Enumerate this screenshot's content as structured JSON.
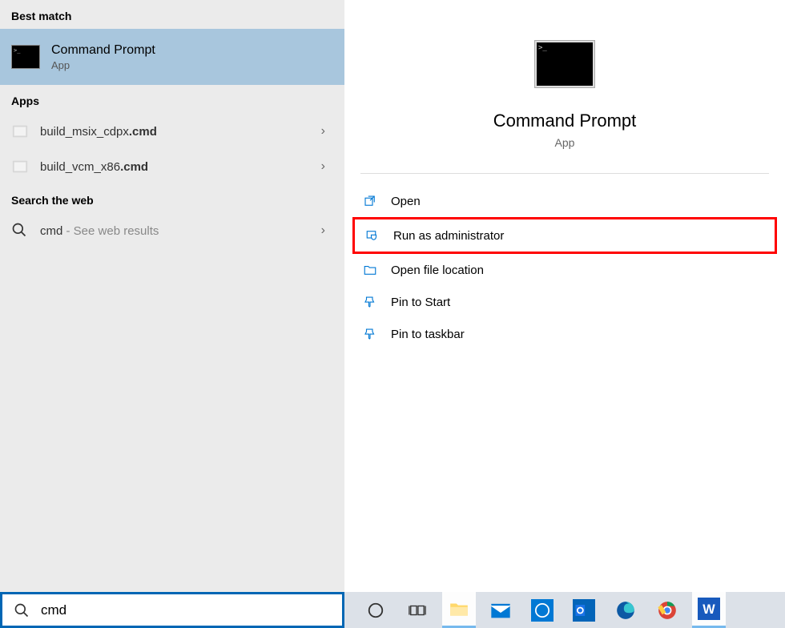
{
  "leftPanel": {
    "sections": {
      "bestMatch": {
        "heading": "Best match",
        "item": {
          "title": "Command Prompt",
          "subtitle": "App"
        }
      },
      "apps": {
        "heading": "Apps",
        "items": [
          {
            "prefix": "build_msix_cdpx",
            "bold": ".cmd"
          },
          {
            "prefix": "build_vcm_x86",
            "bold": ".cmd"
          }
        ]
      },
      "web": {
        "heading": "Search the web",
        "item": {
          "query": "cmd",
          "hint": " - See web results"
        }
      }
    }
  },
  "rightPanel": {
    "title": "Command Prompt",
    "subtitle": "App",
    "actions": [
      {
        "label": "Open",
        "icon": "open",
        "highlight": false
      },
      {
        "label": "Run as administrator",
        "icon": "admin",
        "highlight": true
      },
      {
        "label": "Open file location",
        "icon": "folder",
        "highlight": false
      },
      {
        "label": "Pin to Start",
        "icon": "pin",
        "highlight": false
      },
      {
        "label": "Pin to taskbar",
        "icon": "pin",
        "highlight": false
      }
    ]
  },
  "taskbar": {
    "searchValue": "cmd"
  }
}
